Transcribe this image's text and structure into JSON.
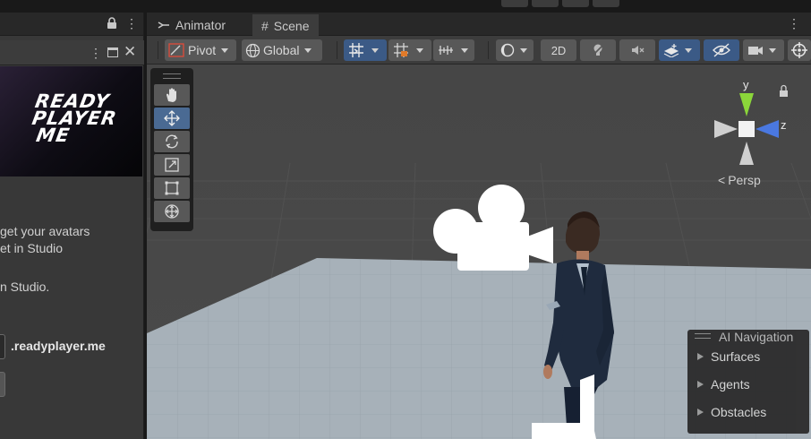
{
  "left_panel": {
    "logo_lines": [
      "READY",
      "PLAYER",
      "ME"
    ],
    "description_lines": [
      "get your avatars",
      "et in Studio"
    ],
    "studio_line": "n Studio.",
    "domain_text": ".readyplayer.me"
  },
  "tabs": [
    {
      "label": "Animator",
      "icon": "animator-icon"
    },
    {
      "label": "Scene",
      "icon": "scene-grid-icon"
    }
  ],
  "toolbar": {
    "pivot_label": "Pivot",
    "global_label": "Global",
    "twod_label": "2D"
  },
  "viewport": {
    "projection_label": "Persp",
    "axis_labels": {
      "y": "y",
      "z": "z"
    }
  },
  "ai_navigation": {
    "title": "AI Navigation",
    "items": [
      "Surfaces",
      "Agents",
      "Obstacles"
    ]
  },
  "colors": {
    "active_blue": "#3b5a86",
    "gizmo_y": "#7ed321",
    "gizmo_z": "#4a78e0",
    "floor": "#a6b0b8",
    "sky": "#474747"
  }
}
